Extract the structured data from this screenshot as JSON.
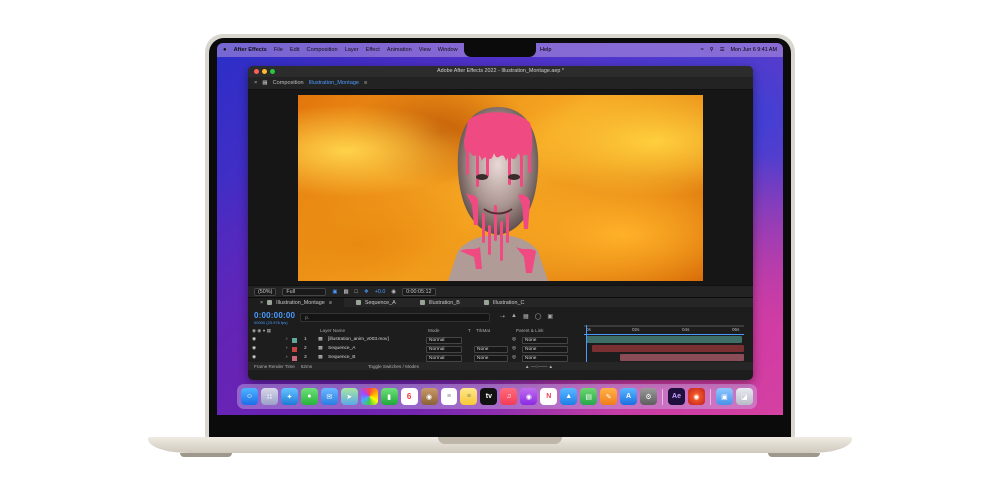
{
  "menubar": {
    "app_name": "After Effects",
    "items": [
      "File",
      "Edit",
      "Composition",
      "Layer",
      "Effect",
      "Animation",
      "View",
      "Window"
    ],
    "help": "Help",
    "clock": "Mon Jun 6  9:41 AM"
  },
  "window": {
    "title": "Adobe After Effects 2022 - Illustration_Montage.aep *"
  },
  "composition": {
    "label": "Composition",
    "name": "Illustration_Montage"
  },
  "viewer_controls": {
    "zoom": "(50%)",
    "resolution": "Full",
    "exposure": "+0.0",
    "timecode": "0:00:05:12"
  },
  "timeline": {
    "tabs": [
      {
        "label": "Illustration_Montage",
        "color": "#9aa59a"
      },
      {
        "label": "Sequence_A",
        "color": "#9aa59a"
      },
      {
        "label": "Illustration_B",
        "color": "#9aa59a"
      },
      {
        "label": "Illustration_C",
        "color": "#9aa59a"
      }
    ],
    "current_time": "0:00:00:00",
    "fps_info": "00000 (23.976 fps)",
    "search_placeholder": "ρ.",
    "columns": {
      "layer_name": "Layer Name",
      "mode": "Mode",
      "t": "T",
      "trkmat": "TrkMat",
      "parent": "Parent & Link"
    },
    "ruler": [
      "0s",
      "02s",
      "04s",
      "06s"
    ],
    "layers": [
      {
        "num": "1",
        "name": "[illustration_anim_v003.mov]",
        "mode": "Normal",
        "trkmat": "",
        "parent": "None",
        "color": "#5fa89a"
      },
      {
        "num": "2",
        "name": "Sequence_A",
        "mode": "Normal",
        "trkmat": "None",
        "parent": "None",
        "color": "#c84444"
      },
      {
        "num": "3",
        "name": "Sequence_B",
        "mode": "Normal",
        "trkmat": "None",
        "parent": "None",
        "color": "#c86a7a"
      }
    ],
    "status_left": "Frame Render Time",
    "status_ms": "52ms",
    "status_center": "Toggle Switches / Modes"
  },
  "colors": {
    "accent": "#4a9bff",
    "ae_bg": "#1d1d1d"
  }
}
